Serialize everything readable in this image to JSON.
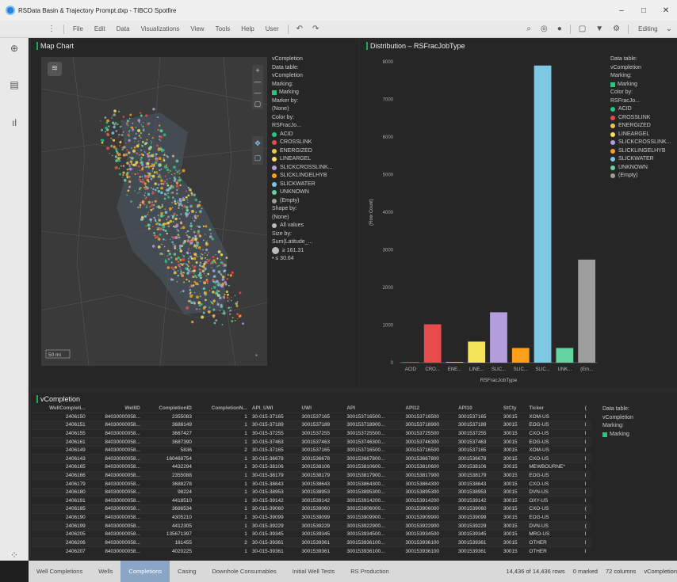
{
  "window": {
    "title": "RSData Basin & Trajectory Prompt.dxp - TIBCO Spotfire",
    "minimize": "–",
    "maximize": "□",
    "close": "✕"
  },
  "toolbar": {
    "menus": [
      "File",
      "Edit",
      "Data",
      "Visualizations",
      "View",
      "Tools",
      "Help",
      "User"
    ],
    "mode": "Editing"
  },
  "map": {
    "title": "Map Chart",
    "scale": "50 mi"
  },
  "map_legend": {
    "lines1": [
      "vCompletion",
      "Data table:",
      "vCompletion",
      "Marking:"
    ],
    "marking": "Marking",
    "lines2": [
      "Marker by:",
      "(None)",
      "Color by:",
      "RSFracJo..."
    ],
    "items": [
      [
        "ACID",
        "#2ec27e"
      ],
      [
        "CROSSLINK",
        "#e84b4b"
      ],
      [
        "ENERGIZED",
        "#e8c84b"
      ],
      [
        "LINEARGEL",
        "#f5e35a"
      ],
      [
        "SLICKCROSSLINK...",
        "#b39ddb"
      ],
      [
        "SLICKLINGELHYB",
        "#ff9f1a"
      ],
      [
        "SLICKWATER",
        "#7ec8e3"
      ],
      [
        "UNKNOWN",
        "#66d4a0"
      ],
      [
        "(Empty)",
        "#9e9e9e"
      ]
    ],
    "lines3": [
      "Shape by:",
      "(None)"
    ],
    "allvalues": "All values",
    "lines4": [
      "Size by:",
      "Sum(Latitude_..."
    ],
    "size_hi": "≥ 161.31",
    "size_lo": "• ≤ 30.64"
  },
  "chart": {
    "title": "Distribution – RSFracJobType"
  },
  "chart_data": {
    "type": "bar",
    "title": "Distribution – RSFracJobType",
    "xlabel": "RSFracJobType",
    "ylabel": "(Row Count)",
    "categories": [
      "ACID",
      "CRO...",
      "ENE...",
      "LINE...",
      "SLIC...",
      "SLIC...",
      "SLIC...",
      "UNK...",
      "(Em..."
    ],
    "values": [
      15,
      1020,
      20,
      560,
      1340,
      390,
      7900,
      390,
      2740
    ],
    "colors": [
      "#2ec27e",
      "#e84b4b",
      "#e8c84b",
      "#f5e35a",
      "#b39ddb",
      "#ff9f1a",
      "#7ec8e3",
      "#66d4a0",
      "#9e9e9e"
    ],
    "ylim": [
      0,
      8000
    ],
    "yticks": [
      0,
      1000,
      2000,
      3000,
      4000,
      5000,
      6000,
      7000,
      8000
    ]
  },
  "chart_legend": {
    "lines": [
      "Data table:",
      "vCompletion",
      "Marking:"
    ],
    "marking": "Marking",
    "lines2": [
      "Color by:",
      "RSFracJo..."
    ],
    "items": [
      [
        "ACID",
        "#2ec27e"
      ],
      [
        "CROSSLINK",
        "#e84b4b"
      ],
      [
        "ENERGIZED",
        "#e8c84b"
      ],
      [
        "LINEARGEL",
        "#f5e35a"
      ],
      [
        "SLICKCROSSLINK...",
        "#b39ddb"
      ],
      [
        "SLICKLINGELHYB",
        "#ff9f1a"
      ],
      [
        "SLICKWATER",
        "#7ec8e3"
      ],
      [
        "UNKNOWN",
        "#66d4a0"
      ],
      [
        "(Empty)",
        "#9e9e9e"
      ]
    ]
  },
  "table": {
    "title": "vCompletion",
    "columns": [
      "WellCompleti...",
      "WellID",
      "CompletionID",
      "CompletionN...",
      "API_UWI",
      "UWI",
      "API",
      "API12",
      "API10",
      "StCty",
      "Ticker",
      "("
    ],
    "rows": [
      [
        "2406150",
        "84030000058...",
        "2355083",
        "1",
        "30-015-37165",
        "3001537165",
        "300153716500...",
        "300153716500",
        "3001537165",
        "30015",
        "XOM-US",
        "I"
      ],
      [
        "2406151",
        "84030000058...",
        "3688149",
        "1",
        "30-015-37189",
        "3001537189",
        "300153718900...",
        "300153718900",
        "3001537189",
        "30015",
        "EOG-US",
        "I"
      ],
      [
        "2406155",
        "84030000058...",
        "3667427",
        "1",
        "30-015-37255",
        "3001537255",
        "300153725500...",
        "300153725500",
        "3001537255",
        "30015",
        "CXO-US",
        "I"
      ],
      [
        "2406161",
        "84030000058...",
        "3687390",
        "1",
        "30-015-37463",
        "3001537463",
        "300153746300...",
        "300153746300",
        "3001537463",
        "30015",
        "EOG-US",
        "I"
      ],
      [
        "2406149",
        "84030000058...",
        "5836",
        "2",
        "30-015-37165",
        "3001537165",
        "300153716500...",
        "300153716500",
        "3001537165",
        "30015",
        "XOM-US",
        "I"
      ],
      [
        "2406143",
        "84030000058...",
        "160468754",
        "1",
        "30-015-36678",
        "3001536678",
        "300153667800...",
        "300153667800",
        "3001536678",
        "30015",
        "CXO-US",
        "I"
      ],
      [
        "2406165",
        "84030000058...",
        "4432294",
        "1",
        "30-015-38106",
        "3001538106",
        "300153810600...",
        "300153810600",
        "3001538106",
        "30015",
        "MEWBOURNE*",
        "I"
      ],
      [
        "2406166",
        "84030000058...",
        "2355088",
        "1",
        "30-015-38179",
        "3001538179",
        "300153817900...",
        "300153817900",
        "3001538179",
        "30015",
        "EOG-US",
        "I"
      ],
      [
        "2406179",
        "84030000058...",
        "3688278",
        "1",
        "30-015-38643",
        "3001538643",
        "300153864300...",
        "300153864300",
        "3001538643",
        "30015",
        "CXO-US",
        "I"
      ],
      [
        "2406180",
        "84030000058...",
        "98224",
        "1",
        "30-015-38953",
        "3001538953",
        "300153895300...",
        "300153895300",
        "3001538953",
        "30015",
        "DVN-US",
        "I"
      ],
      [
        "2406191",
        "84030000058...",
        "4418510",
        "1",
        "30-015-39142",
        "3001539142",
        "300153914200...",
        "300153914200",
        "3001539142",
        "30015",
        "OXY-US",
        "I"
      ],
      [
        "2406185",
        "84030000058...",
        "3686534",
        "1",
        "30-015-39060",
        "3001539060",
        "300153906000...",
        "300153906000",
        "3001539060",
        "30015",
        "CXO-US",
        "("
      ],
      [
        "2406190",
        "84030000058...",
        "4305210",
        "1",
        "30-015-39099",
        "3001539099",
        "300153909900...",
        "300153909900",
        "3001539099",
        "30015",
        "EOG-US",
        "I"
      ],
      [
        "2406199",
        "84030000058...",
        "4412305",
        "1",
        "30-015-39229",
        "3001539229",
        "300153922900...",
        "300153922900",
        "3001539229",
        "30015",
        "DVN-US",
        "("
      ],
      [
        "2406205",
        "84030000058...",
        "135671397",
        "1",
        "30-015-39345",
        "3001539345",
        "300153934500...",
        "300153934500",
        "3001539345",
        "30015",
        "MRO-US",
        "I"
      ],
      [
        "2406206",
        "84030000058...",
        "181455",
        "2",
        "30-015-39361",
        "3001539361",
        "300153936100...",
        "300153936100",
        "3001539361",
        "30015",
        "OTHER",
        "I"
      ],
      [
        "2406207",
        "84030000058...",
        "4020225",
        "1",
        "30-015-39361",
        "3001539361",
        "300153936100...",
        "300153936100",
        "3001539361",
        "30015",
        "OTHER",
        "I"
      ]
    ]
  },
  "table_legend": {
    "lines": [
      "Data table:",
      "vCompletion",
      "Marking:"
    ],
    "marking": "Marking"
  },
  "tabs": [
    "Well Completions",
    "Wells",
    "Completions",
    "Casing",
    "Downhole Consumables",
    "Initial Well Tests",
    "RS Production"
  ],
  "active_tab": "Completions",
  "status": {
    "rows": "14,436 of 14,436 rows",
    "marked": "0 marked",
    "columns": "72 columns",
    "table": "vCompletion"
  }
}
